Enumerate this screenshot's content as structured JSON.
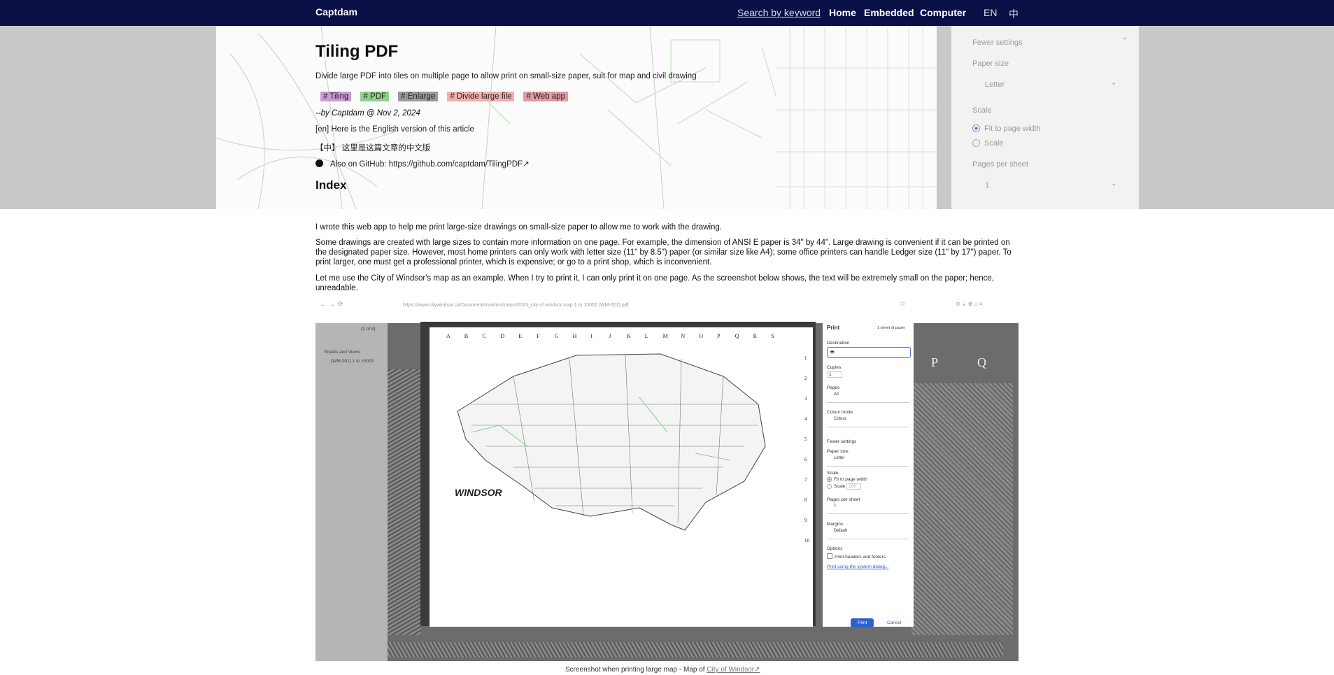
{
  "nav": {
    "brand": "Captdam",
    "search_label": "Search by keyword",
    "links": [
      "Home",
      "Embedded",
      "Computer"
    ],
    "lang_en": "EN",
    "lang_zh": "中"
  },
  "hero_panel": {
    "fewer_settings": "Fewer settings",
    "paper_size_label": "Paper size",
    "paper_size_value": "Letter",
    "scale_label": "Scale",
    "scale_fit": "Fit to page width",
    "scale_custom": "Scale",
    "pages_per_sheet_label": "Pages per sheet",
    "pages_per_sheet_value": "1"
  },
  "article": {
    "title": "Tiling PDF",
    "subtitle": "Divide large PDF into tiles on multiple page to allow print on small-size paper, suit for map and civil drawing",
    "tags": [
      {
        "label": "# Tiling",
        "color": "#c99ad3"
      },
      {
        "label": "# PDF",
        "color": "#8fd08a"
      },
      {
        "label": "# Enlarge",
        "color": "#9a9a9a"
      },
      {
        "label": "# Divide large file",
        "color": "#f0b0b0"
      },
      {
        "label": "# Web app",
        "color": "#e09aa4"
      }
    ],
    "byline": "--by Captdam @ Nov 2, 2024",
    "english_note": "[en] Here is the English version of this article",
    "chinese_note": "【中】 这里是这篇文章的中文版",
    "github_prefix": "Also on GitHub:",
    "github_link": "https://github.com/captdam/TilingPDF↗",
    "index_heading": "Index",
    "paragraphs": [
      "I wrote this web app to help me print large-size drawings on small-size paper to allow me to work with the drawing.",
      "Some drawings are created with large sizes to contain more information on one page. For example, the dimension of ANSI E paper is 34\" by 44\". Large drawing is convenient if it can be printed on the designated paper size. However, most home printers can only work with letter size (11\" by 8.5\") paper (or similar size like A4); some office printers can handle Ledger size (11\" by 17\") paper. To print larger, one must get a professional printer, which is expensive; or go to a print shop, which is inconvenient.",
      "Let me use the City of Windsor's map as an example. When I try to print it, I can only print it on one page. As the screenshot below shows, the text will be extremely small on the paper; hence, unreadable."
    ]
  },
  "screenshot": {
    "url": "https://www.citywindsor.ca/Documents/visitors/maps/2023_city of windsor map 1 to 15000 (WM-001).pdf",
    "sidebar_page": "(1 of 8)",
    "sidebar_heading": "Sheets and Views",
    "sidebar_item": "(WM-001) 1 to 15000",
    "bg_letters": [
      "P",
      "Q"
    ],
    "col_letters": [
      "A",
      "B",
      "C",
      "D",
      "E",
      "F",
      "G",
      "H",
      "I",
      "J",
      "K",
      "L",
      "M",
      "N",
      "O",
      "P",
      "Q",
      "R",
      "S"
    ],
    "row_numbers": [
      "1",
      "2",
      "3",
      "4",
      "5",
      "6",
      "7",
      "8",
      "9",
      "10"
    ],
    "map_title": "WINDSOR",
    "dialog": {
      "title": "Print",
      "sheets": "1 sheet of paper",
      "destination": "Destination",
      "copies": "Copies",
      "copies_value": "1",
      "pages": "Pages",
      "pages_value": "All",
      "colour_mode": "Colour mode",
      "colour_value": "Colour",
      "fewer_settings": "Fewer settings",
      "paper_size": "Paper size",
      "paper_value": "Letter",
      "scale": "Scale",
      "scale_fit": "Fit to page width",
      "scale_custom": "Scale",
      "scale_value": "100",
      "pages_per_sheet": "Pages per sheet",
      "pages_per_sheet_value": "1",
      "margins": "Margins",
      "margins_value": "Default",
      "options": "Options",
      "headers_footers": "Print headers and footers",
      "system_dialog": "Print using the system dialog...",
      "print_btn": "Print",
      "cancel_btn": "Cancel"
    }
  },
  "caption": {
    "text": "Screenshot when printing large map - Map of",
    "link": "City of Windsor↗"
  }
}
